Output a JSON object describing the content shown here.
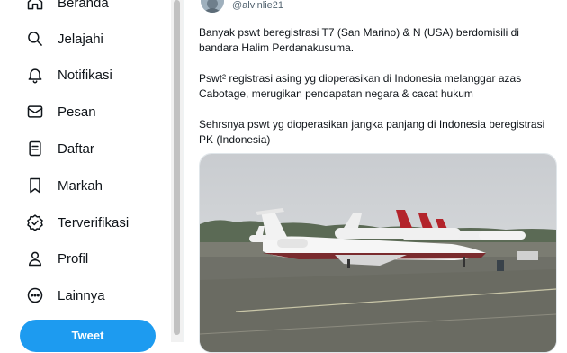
{
  "sidebar": {
    "items": [
      {
        "label": "Beranda",
        "icon": "home-icon"
      },
      {
        "label": "Jelajahi",
        "icon": "search-icon"
      },
      {
        "label": "Notifikasi",
        "icon": "bell-icon"
      },
      {
        "label": "Pesan",
        "icon": "mail-icon"
      },
      {
        "label": "Daftar",
        "icon": "list-icon"
      },
      {
        "label": "Markah",
        "icon": "bookmark-icon"
      },
      {
        "label": "Terverifikasi",
        "icon": "verified-icon"
      },
      {
        "label": "Profil",
        "icon": "person-icon"
      },
      {
        "label": "Lainnya",
        "icon": "more-icon"
      }
    ],
    "tweet_button": "Tweet"
  },
  "tweet": {
    "handle": "@alvinlie21",
    "paragraphs": [
      "Banyak pswt beregistrasi T7 (San Marino) & N (USA) berdomisili di",
      "bandara Halim Perdanakusuma.",
      "Pswt² registrasi asing yg dioperasikan di Indonesia melanggar azas",
      "Cabotage, merugikan pendapatan negara & cacat hukum",
      "Sehrsnya pswt yg dioperasikan jangka panjang di Indonesia beregistrasi",
      "PK (Indonesia)"
    ]
  },
  "colors": {
    "accent": "#1d9bf0",
    "text": "#0f1419",
    "muted": "#536471"
  }
}
